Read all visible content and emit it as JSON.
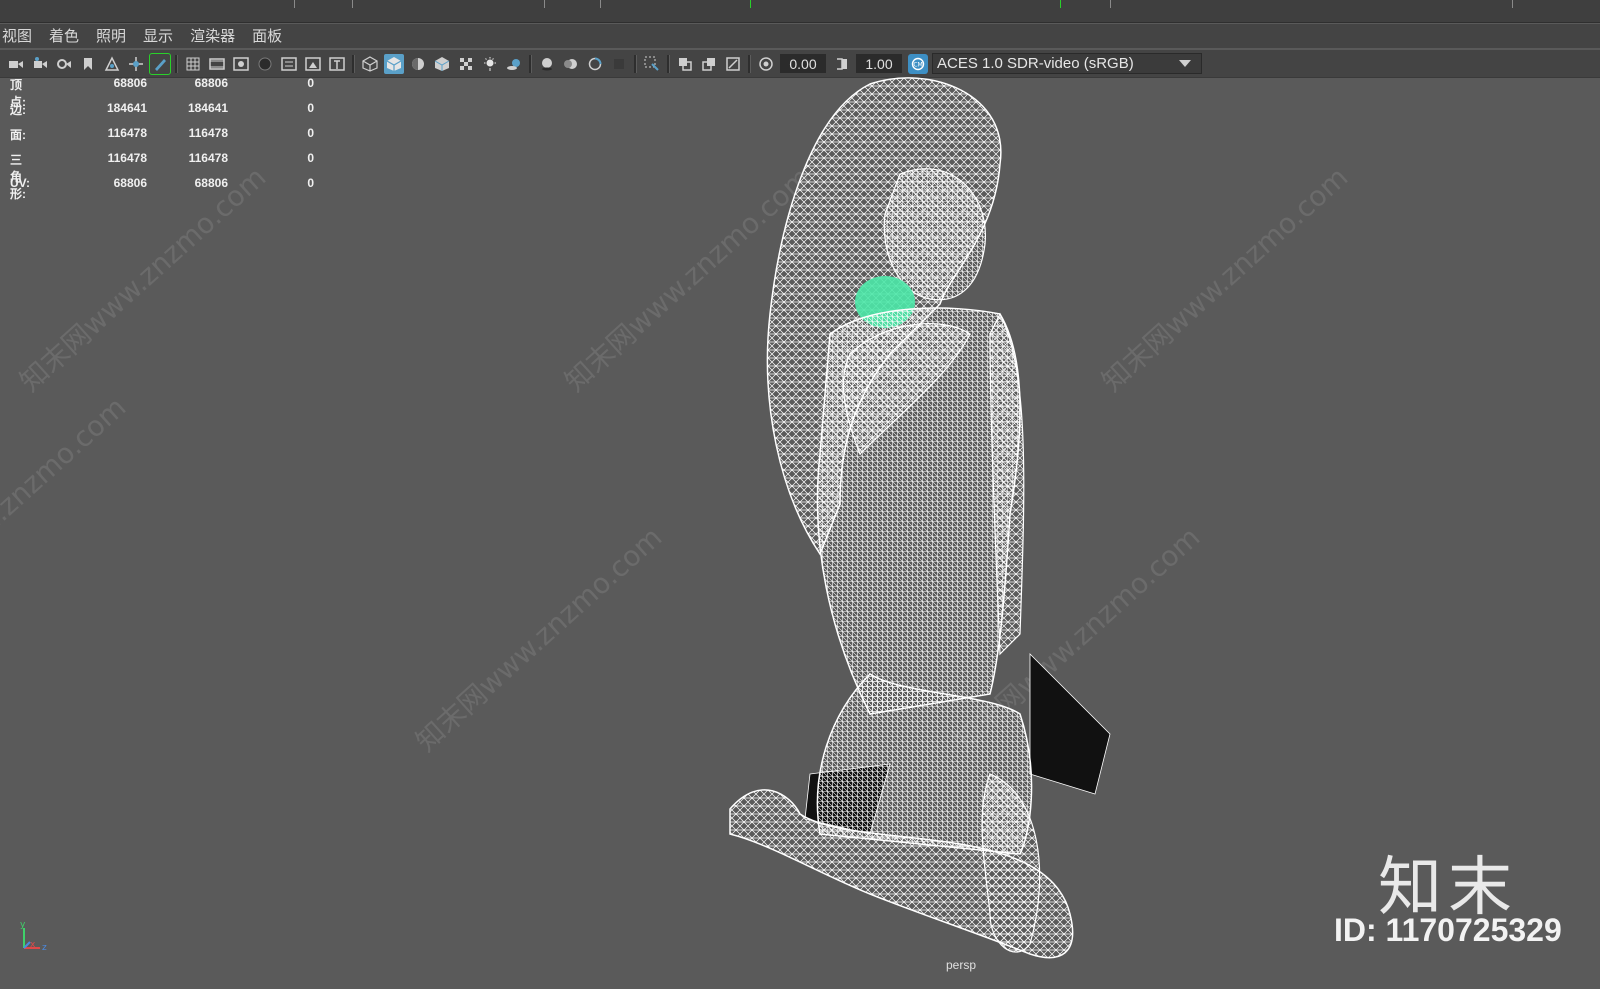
{
  "menubar": {
    "items": [
      "视图",
      "着色",
      "照明",
      "显示",
      "渲染器",
      "面板"
    ]
  },
  "toolbar": {
    "exposure_value": "0.00",
    "gamma_value": "1.00",
    "color_space": "ACES 1.0 SDR-video (sRGB)",
    "icons": [
      "camera-icon",
      "camera-attributes-icon",
      "bookmark-icon",
      "image-plane-icon",
      "grid-icon",
      "film-gate-icon",
      "resolution-gate-icon",
      "wireframe-icon",
      "smooth-shade-icon",
      "lights-icon",
      "shadows-icon",
      "isolate-select-icon",
      "xray-icon",
      "exposure-icon",
      "gamma-icon",
      "color-management-icon"
    ]
  },
  "hud": {
    "rows": [
      {
        "label": "顶点:",
        "v1": "68806",
        "v2": "68806",
        "v3": "0"
      },
      {
        "label": "边:",
        "v1": "184641",
        "v2": "184641",
        "v3": "0"
      },
      {
        "label": "面:",
        "v1": "116478",
        "v2": "116478",
        "v3": "0"
      },
      {
        "label": "三角形:",
        "v1": "116478",
        "v2": "116478",
        "v3": "0"
      },
      {
        "label": "UV:",
        "v1": "68806",
        "v2": "68806",
        "v3": "0"
      }
    ]
  },
  "viewport": {
    "camera_label": "persp",
    "background_color": "#5a5a5a",
    "wire_color": "#ffffff",
    "highlight_color": "#4de8a8"
  },
  "watermark": {
    "text": "知末网www.znzmo.com",
    "brand": "知末",
    "image_id": "ID: 1170725329"
  },
  "axis": {
    "y": "y",
    "x": "x",
    "z": "z"
  }
}
